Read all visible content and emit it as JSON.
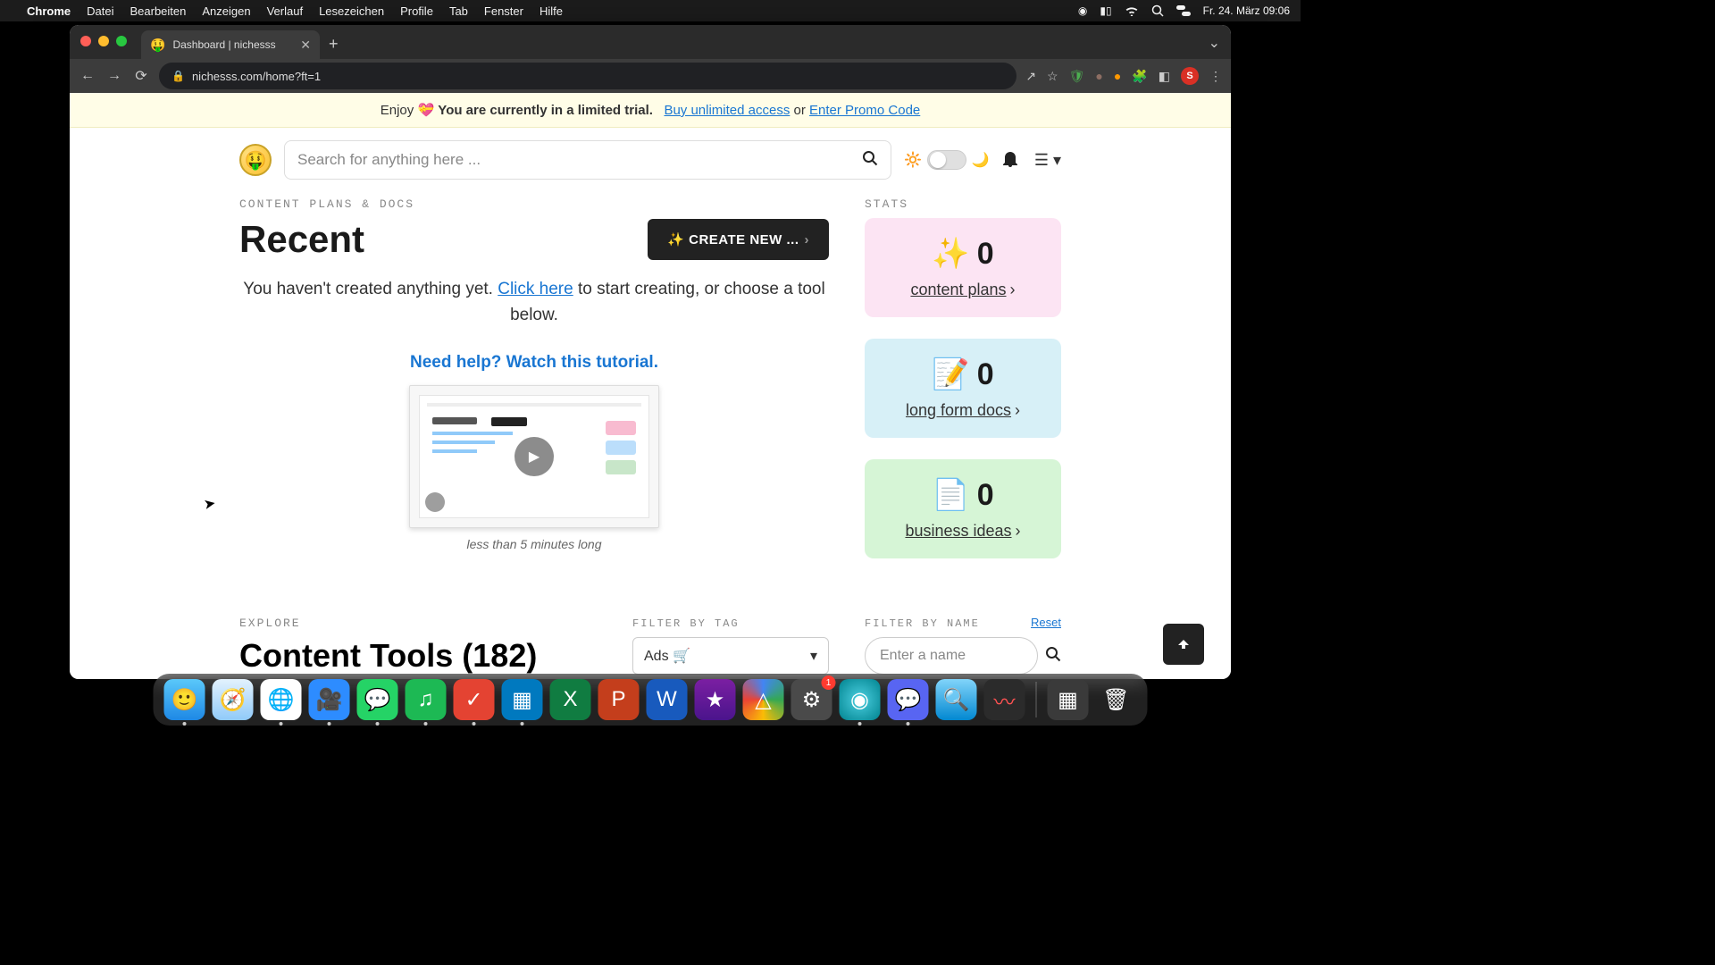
{
  "menubar": {
    "app": "Chrome",
    "items": [
      "Datei",
      "Bearbeiten",
      "Anzeigen",
      "Verlauf",
      "Lesezeichen",
      "Profile",
      "Tab",
      "Fenster",
      "Hilfe"
    ],
    "clock": "Fr. 24. März  09:06"
  },
  "tab": {
    "title": "Dashboard | nichesss",
    "favicon": "🤑"
  },
  "url": "nichesss.com/home?ft=1",
  "avatar_letter": "S",
  "banner": {
    "prefix": "Enjoy ",
    "bold": "You are currently in a limited trial.",
    "buy": "Buy unlimited access",
    "or": " or ",
    "promo": "Enter Promo Code"
  },
  "search": {
    "placeholder": "Search for anything here ..."
  },
  "section": {
    "eyebrow": "CONTENT PLANS & DOCS",
    "title": "Recent",
    "create_btn": "✨ CREATE NEW ...",
    "empty_pre": "You haven't created anything yet. ",
    "empty_link": "Click here",
    "empty_post": " to start creating, or choose a tool below.",
    "tutorial": "Need help? Watch this tutorial.",
    "video_caption": "less than 5 minutes long"
  },
  "stats": {
    "eyebrow": "STATS",
    "cards": [
      {
        "emoji": "✨",
        "value": "0",
        "label": "content plans"
      },
      {
        "emoji": "📝",
        "value": "0",
        "label": "long form docs"
      },
      {
        "emoji": "📄",
        "value": "0",
        "label": "business ideas"
      }
    ]
  },
  "explore": {
    "eyebrow": "EXPLORE",
    "title": "Content Tools (182)",
    "filter_tag_label": "FILTER BY TAG",
    "filter_tag_value": "Ads 🛒",
    "filter_name_label": "FILTER BY NAME",
    "filter_name_placeholder": "Enter a name",
    "reset": "Reset"
  },
  "dock_badge": "1"
}
